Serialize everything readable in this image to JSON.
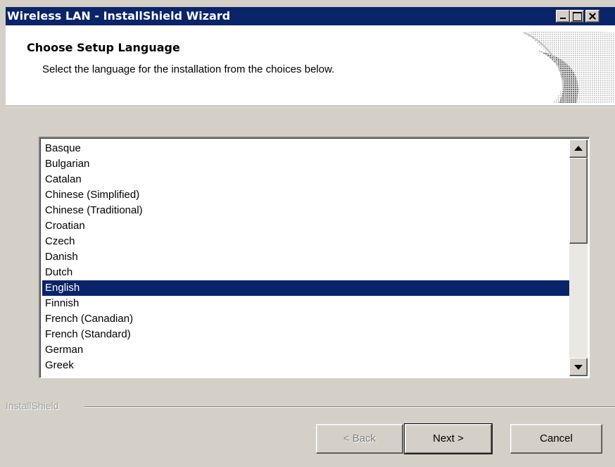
{
  "window": {
    "title": "Wireless LAN - InstallShield Wizard"
  },
  "header": {
    "title": "Choose Setup Language",
    "subtitle": "Select the language for the installation from the choices below."
  },
  "languages": {
    "items": [
      "Basque",
      "Bulgarian",
      "Catalan",
      "Chinese (Simplified)",
      "Chinese (Traditional)",
      "Croatian",
      "Czech",
      "Danish",
      "Dutch",
      "English",
      "Finnish",
      "French (Canadian)",
      "French (Standard)",
      "German",
      "Greek"
    ],
    "selected": "English"
  },
  "brand": {
    "label": "InstallShield"
  },
  "buttons": {
    "back": "< Back",
    "next": "Next >",
    "cancel": "Cancel"
  },
  "colors": {
    "titlebar": "#0a246a",
    "selection": "#0a246a",
    "face": "#d4d0c8"
  },
  "icons": {
    "minimize": "minimize-icon",
    "maximize": "maximize-icon",
    "close": "close-icon"
  }
}
